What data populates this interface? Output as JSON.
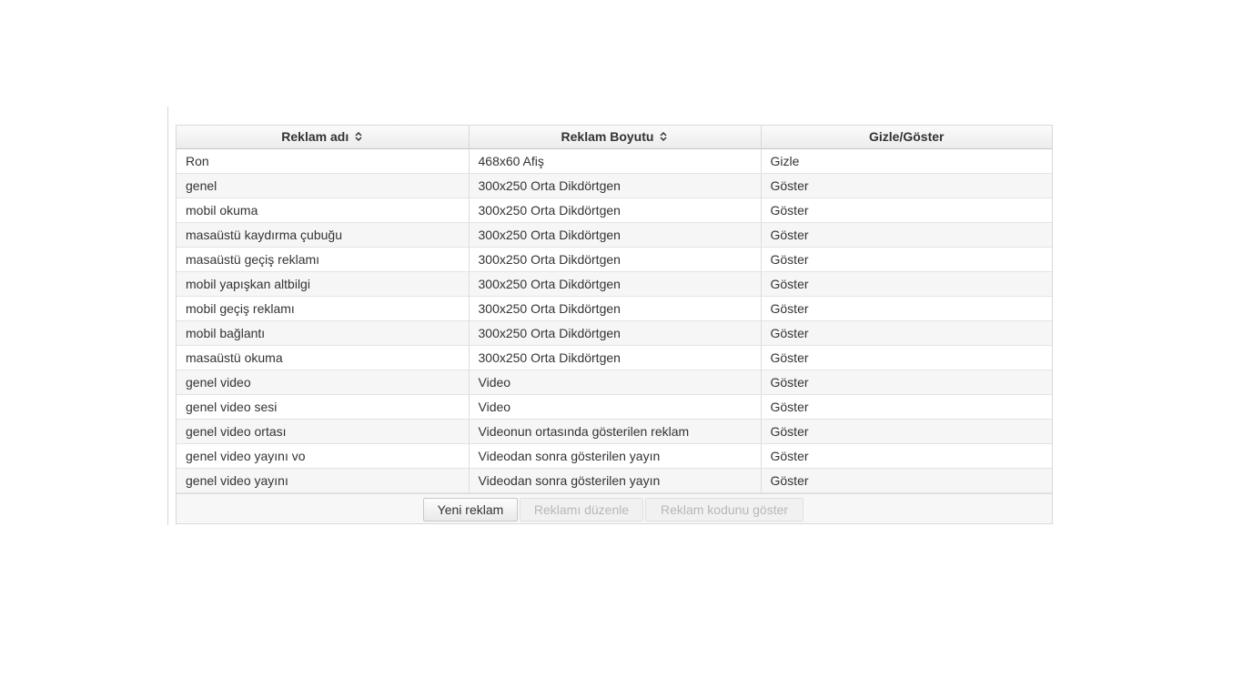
{
  "table": {
    "columns": [
      {
        "label": "Reklam adı",
        "sortable": true
      },
      {
        "label": "Reklam Boyutu",
        "sortable": true
      },
      {
        "label": "Gizle/Göster",
        "sortable": false
      }
    ],
    "rows": [
      [
        "Ron",
        "468x60 Afiş",
        "Gizle"
      ],
      [
        "genel",
        "300x250 Orta Dikdörtgen",
        "Göster"
      ],
      [
        "mobil okuma",
        "300x250 Orta Dikdörtgen",
        "Göster"
      ],
      [
        "masaüstü kaydırma çubuğu",
        "300x250 Orta Dikdörtgen",
        "Göster"
      ],
      [
        "masaüstü geçiş reklamı",
        "300x250 Orta Dikdörtgen",
        "Göster"
      ],
      [
        "mobil yapışkan altbilgi",
        "300x250 Orta Dikdörtgen",
        "Göster"
      ],
      [
        "mobil geçiş reklamı",
        "300x250 Orta Dikdörtgen",
        "Göster"
      ],
      [
        "mobil bağlantı",
        "300x250 Orta Dikdörtgen",
        "Göster"
      ],
      [
        "masaüstü okuma",
        "300x250 Orta Dikdörtgen",
        "Göster"
      ],
      [
        "genel video",
        "Video",
        "Göster"
      ],
      [
        "genel video sesi",
        "Video",
        "Göster"
      ],
      [
        "genel video ortası",
        "Videonun ortasında gösterilen reklam",
        "Göster"
      ],
      [
        "genel video yayını vo",
        "Videodan sonra gösterilen yayın",
        "Göster"
      ],
      [
        "genel video yayını",
        "Videodan sonra gösterilen yayın",
        "Göster"
      ]
    ]
  },
  "toolbar": {
    "new_label": "Yeni reklam",
    "edit_label": "Reklamı düzenle",
    "code_label": "Reklam kodunu göster"
  },
  "icons": {
    "sort": "sort-icon"
  }
}
